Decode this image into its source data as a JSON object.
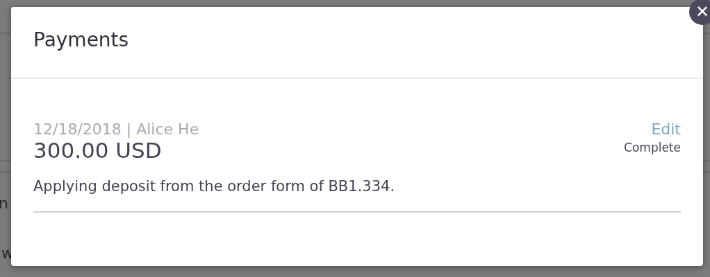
{
  "background": {
    "texts": [
      "n",
      "w"
    ]
  },
  "dialog": {
    "title": "Payments",
    "close": "✕",
    "payments": [
      {
        "meta": "12/18/2018 | Alice He",
        "action": "Edit",
        "amount": "300.00 USD",
        "status": "Complete",
        "note": "Applying deposit from the order form of BB1.334."
      }
    ]
  }
}
